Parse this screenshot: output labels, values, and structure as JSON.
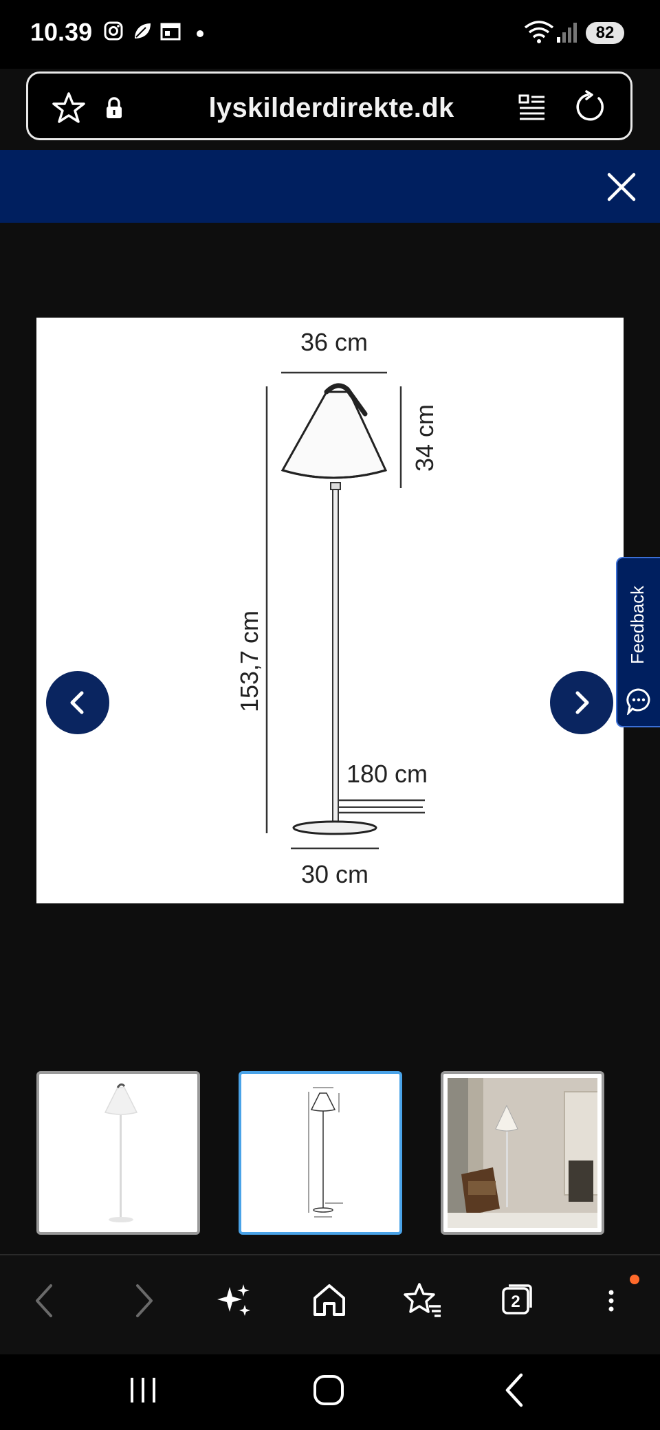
{
  "status_bar": {
    "time": "10.39",
    "battery": "82"
  },
  "browser": {
    "url": "lyskilderdirekte.dk"
  },
  "product_image": {
    "dimensions": {
      "shade_width": "36 cm",
      "shade_height": "34 cm",
      "total_height": "153,7 cm",
      "cable_length": "180 cm",
      "base_diameter": "30 cm"
    }
  },
  "feedback": {
    "label": "Feedback"
  },
  "thumbnails": [
    {
      "name": "lamp-white-background",
      "selected": false
    },
    {
      "name": "lamp-dimension-drawing",
      "selected": true
    },
    {
      "name": "lamp-living-room",
      "selected": false
    }
  ],
  "toolbar": {
    "tabs_count": "2"
  },
  "colors": {
    "brand_navy": "#001f5f",
    "selected_thumb_border": "#4aa3e8",
    "notification_dot": "#ff6a2b"
  }
}
